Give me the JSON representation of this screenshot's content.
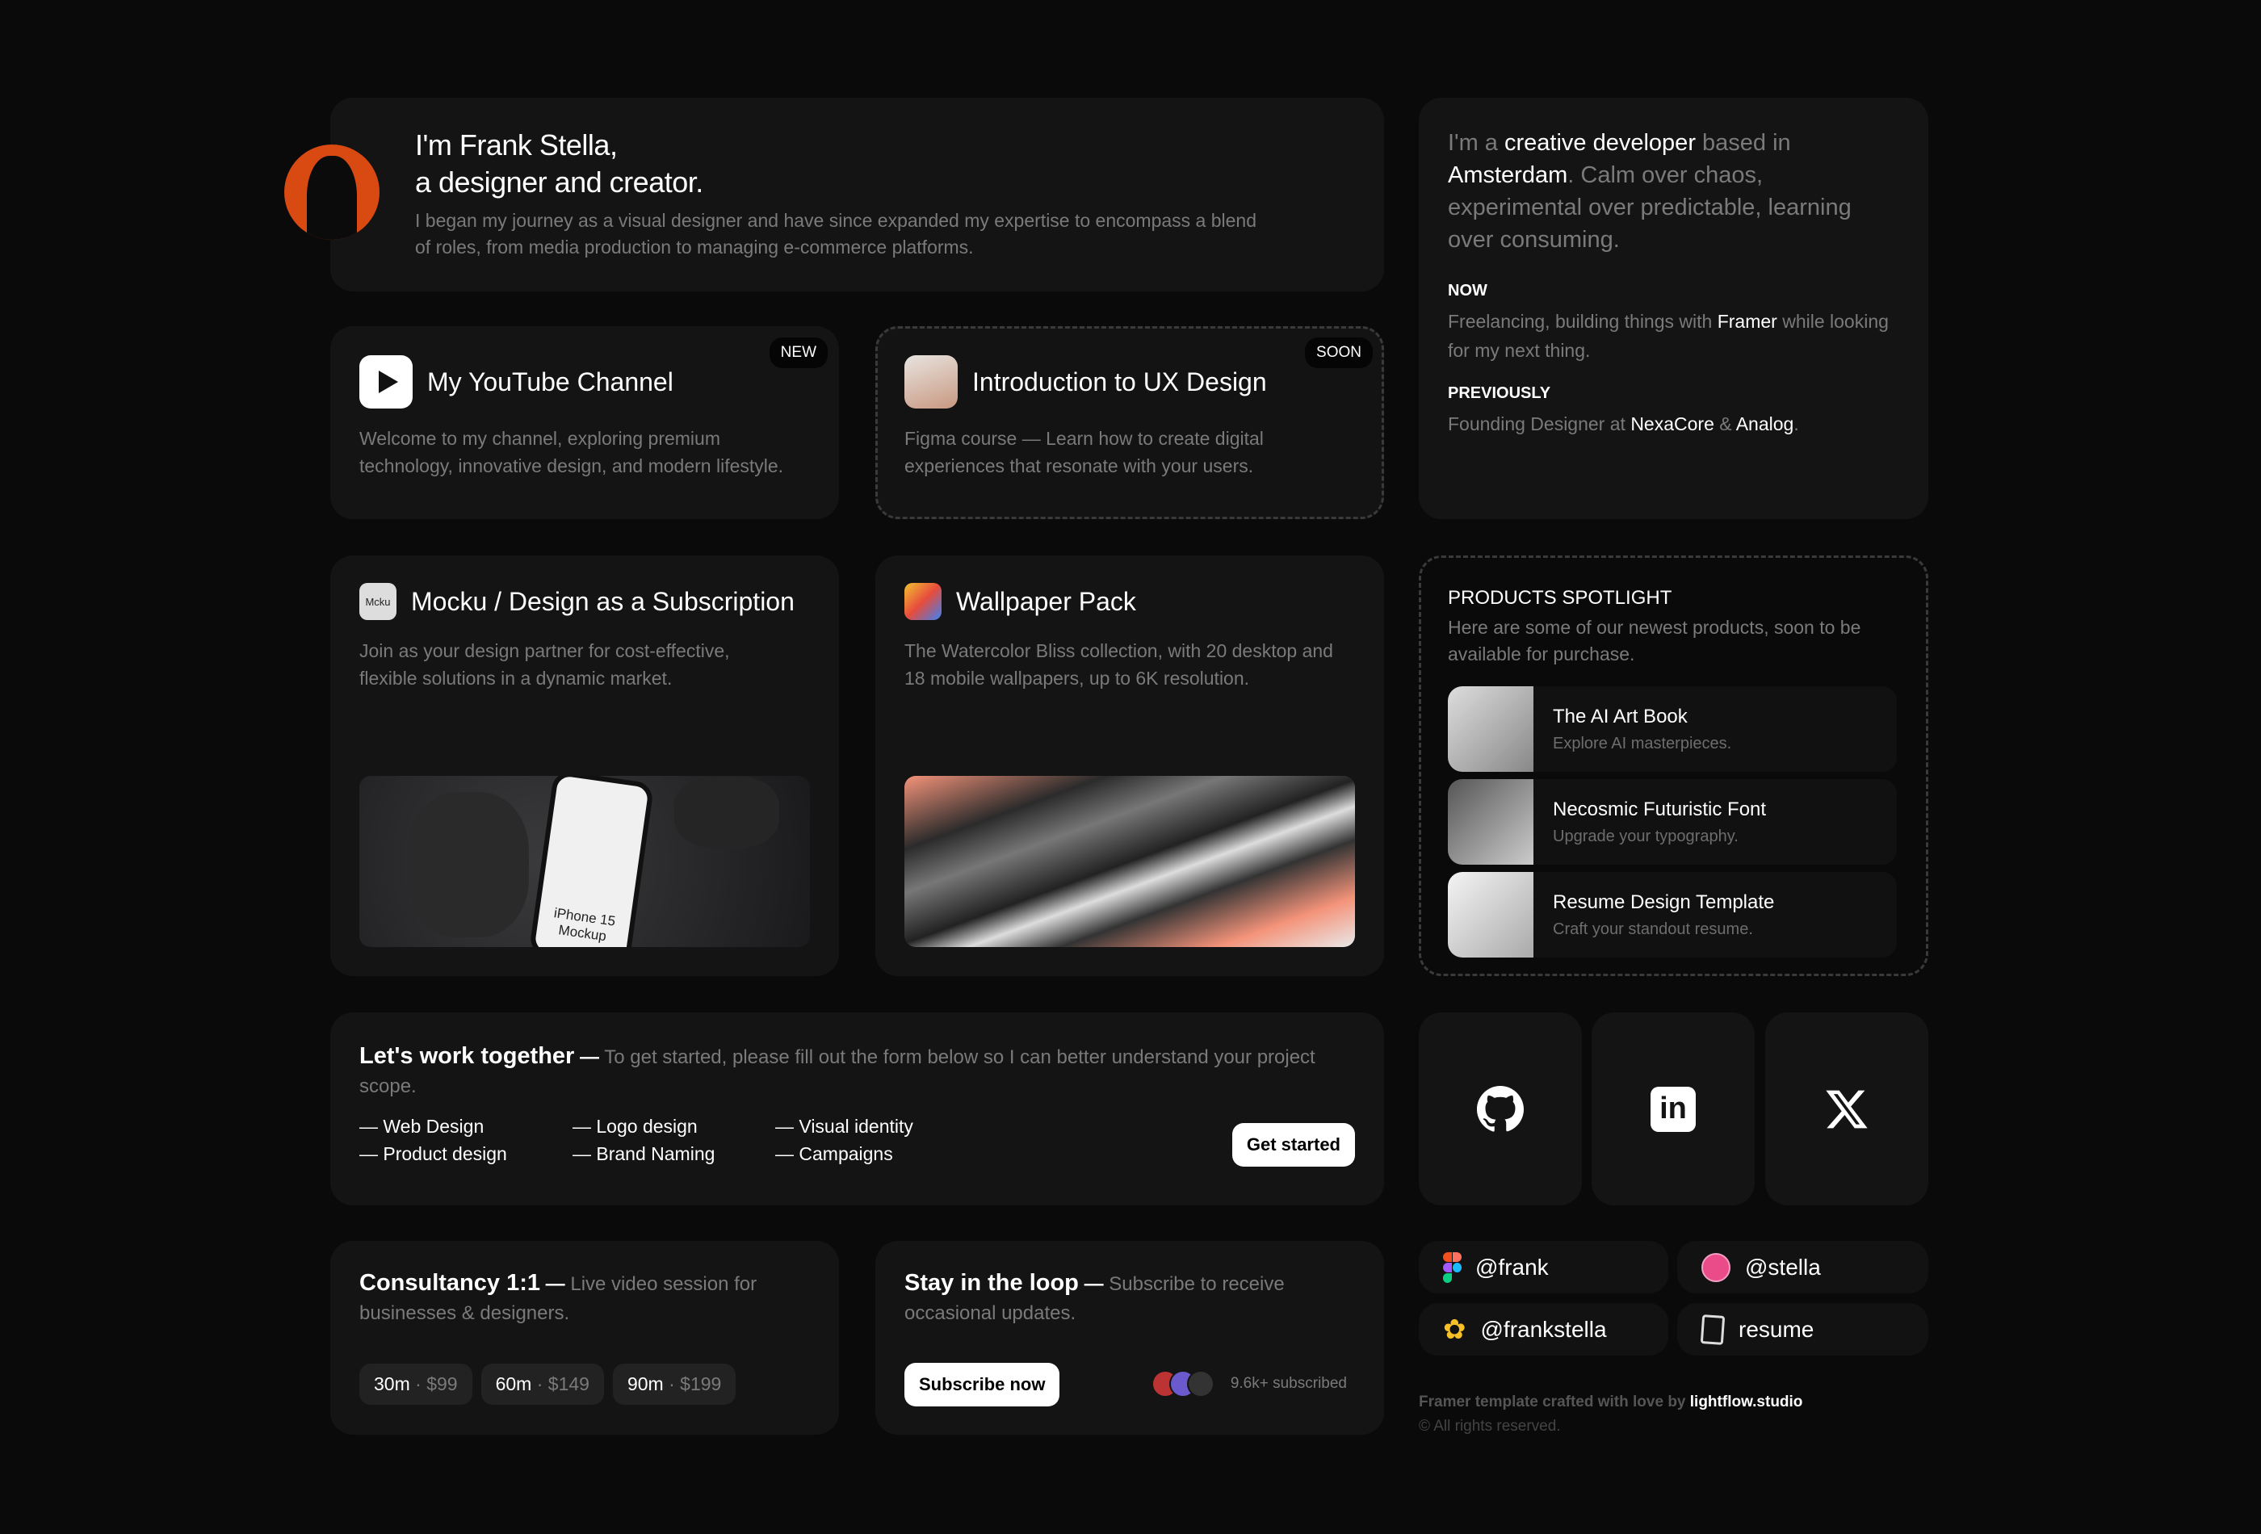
{
  "intro": {
    "title_line1": "I'm Frank Stella,",
    "title_line2": "a designer and creator.",
    "description": "I began my journey as a visual designer and have since expanded my expertise to encompass a blend of roles, from media production to managing e-commerce platforms."
  },
  "bio": {
    "p1": "I'm a ",
    "h1": "creative developer",
    "p2": " based in ",
    "h2": "Amsterdam",
    "p3": ". Calm over chaos, experimental over predictable, learning over consuming.",
    "now_label": "NOW",
    "now_text1": "Freelancing, building things with ",
    "now_link": "Framer",
    "now_text2": " while looking for my next thing.",
    "prev_label": "PREVIOUSLY",
    "prev_text1": "Founding Designer at ",
    "prev_link1": "NexaCore",
    "prev_amp": " & ",
    "prev_link2": "Analog",
    "prev_end": "."
  },
  "cards": {
    "youtube": {
      "title": "My YouTube Channel",
      "badge": "NEW",
      "description": "Welcome to my channel, exploring premium technology, innovative design, and modern lifestyle."
    },
    "ux": {
      "title": "Introduction to UX Design",
      "badge": "SOON",
      "description": "Figma course — Learn how to create digital experiences that resonate with your users."
    },
    "mocku": {
      "title": "Mocku / Design as a Subscription",
      "description": "Join as your design partner for cost-effective, flexible solutions in a dynamic market.",
      "image_label": "iPhone 15 Mockup",
      "logo_text": "Mcku"
    },
    "wallpaper": {
      "title": "Wallpaper Pack",
      "description": "The Watercolor Bliss collection, with 20 desktop and 18 mobile wallpapers, up to 6K resolution."
    }
  },
  "products": {
    "title": "PRODUCTS SPOTLIGHT",
    "description": "Here are some of our newest products, soon to be available for purchase.",
    "items": [
      {
        "name": "The AI Art Book",
        "sub": "Explore AI masterpieces."
      },
      {
        "name": "Necosmic Futuristic Font",
        "sub": "Upgrade your typography."
      },
      {
        "name": "Resume Design Template",
        "sub": "Craft your standout resume."
      }
    ]
  },
  "work": {
    "title": "Let's work together",
    "dash": "—",
    "description": "To get started, please fill out the form below so I can better understand your project scope.",
    "services": [
      "— Web Design",
      "— Product design",
      "— Logo design",
      "— Brand Naming",
      "— Visual identity",
      "— Campaigns"
    ],
    "cta": "Get started"
  },
  "social": {
    "icons": [
      "github-icon",
      "linkedin-icon",
      "x-icon"
    ]
  },
  "consult": {
    "title": "Consultancy 1:1",
    "dash": "—",
    "description": "Live video session for businesses & designers.",
    "options": [
      {
        "dur": "30m",
        "price": "$99"
      },
      {
        "dur": "60m",
        "price": "$149"
      },
      {
        "dur": "90m",
        "price": "$199"
      }
    ],
    "sep": " · "
  },
  "loop": {
    "title": "Stay in the loop",
    "dash": "—",
    "description": "Subscribe to receive occasional updates.",
    "cta": "Subscribe now",
    "count": "9.6k+ subscribed"
  },
  "handles": [
    {
      "icon": "figma-icon",
      "label": "@frank"
    },
    {
      "icon": "dribbble-icon",
      "label": "@stella"
    },
    {
      "icon": "flower-icon",
      "label": "@frankstella"
    },
    {
      "icon": "document-icon",
      "label": "resume"
    }
  ],
  "footer": {
    "text": "Framer template crafted with love by ",
    "link": "lightflow.studio",
    "copyright": "© All rights reserved."
  },
  "colors": {
    "background": "#0a0a0a",
    "card": "#141414",
    "avatar": "#d94a12",
    "accent_peach": "#f4937a"
  }
}
